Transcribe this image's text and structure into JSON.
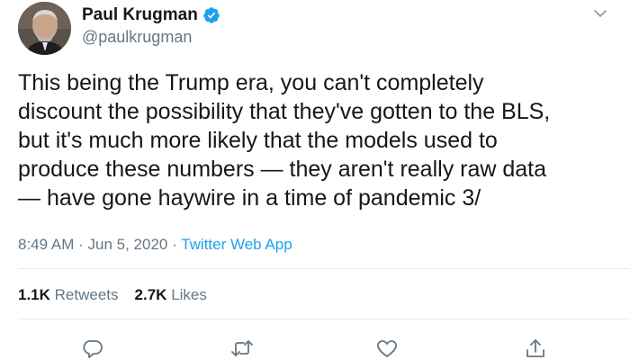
{
  "author": {
    "display_name": "Paul Krugman",
    "handle": "@paulkrugman"
  },
  "tweet": {
    "lines": [
      "This being the Trump era, you can't completely",
      "discount the possibility that they've gotten to the BLS,",
      "but it's much more likely that the models used to",
      "produce these numbers — they aren't really raw data",
      "— have gone haywire in a time of pandemic 3/"
    ]
  },
  "meta": {
    "time": "8:49 AM",
    "date": "Jun 5, 2020",
    "source": "Twitter Web App",
    "separator": "·"
  },
  "stats": {
    "retweets_count": "1.1K",
    "retweets_label": "Retweets",
    "likes_count": "2.7K",
    "likes_label": "Likes"
  },
  "icons": {
    "verified": "verified-badge-icon",
    "more": "chevron-down-icon",
    "reply": "reply-icon",
    "retweet": "retweet-icon",
    "like": "heart-icon",
    "share": "share-icon"
  },
  "colors": {
    "verified": "#1da1f2",
    "link": "#1da1f2",
    "muted": "#657786",
    "divider": "#e6ecf0"
  }
}
